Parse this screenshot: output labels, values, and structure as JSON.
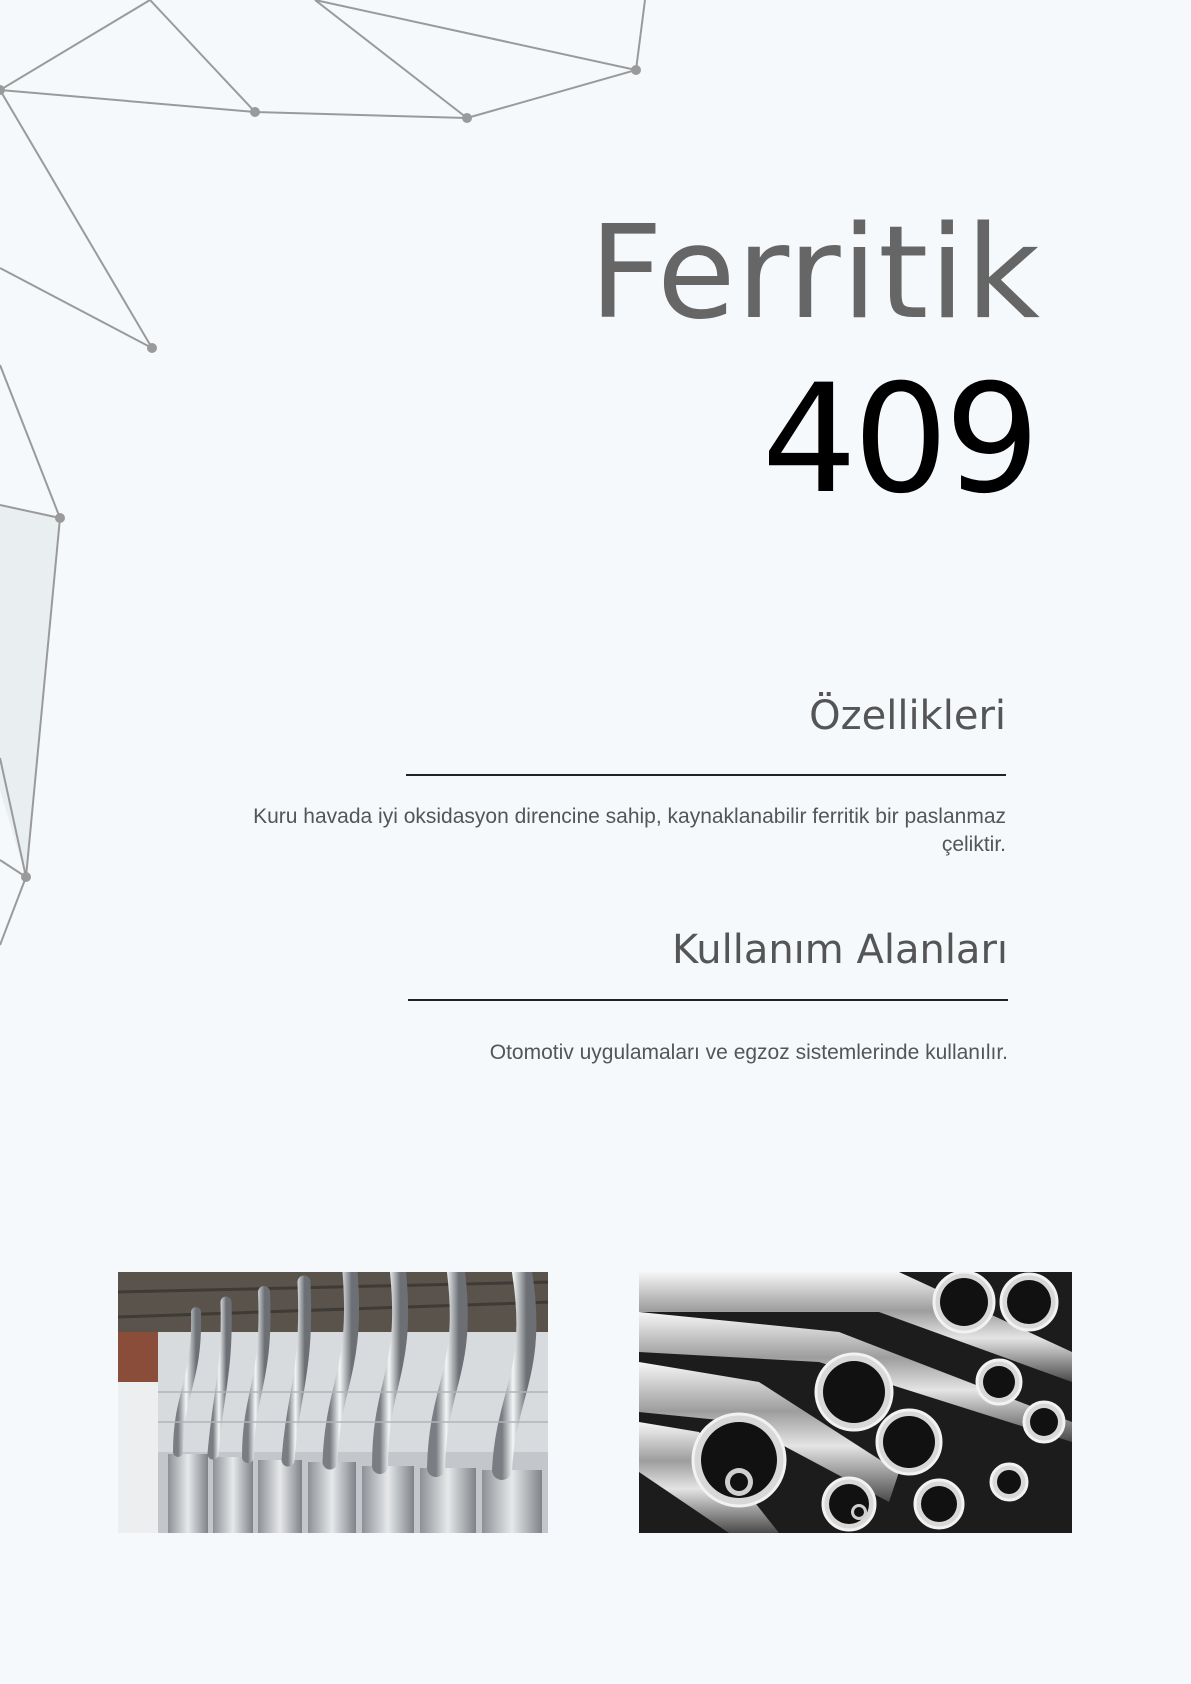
{
  "title": {
    "word": "Ferritik",
    "grade": "409"
  },
  "sections": [
    {
      "heading": "Özellikleri",
      "text": "Kuru havada iyi oksidasyon direncine sahip, kaynaklanabilir ferritik bir paslanmaz çeliktir."
    },
    {
      "heading": "Kullanım Alanları",
      "text": "Otomotiv uygulamaları ve egzoz sistemlerinde kullanılır."
    }
  ],
  "colors": {
    "background": "#f5f9fc",
    "title": "#666666",
    "grade": "#000000",
    "text": "#555555",
    "network": "#9a9a9a"
  }
}
